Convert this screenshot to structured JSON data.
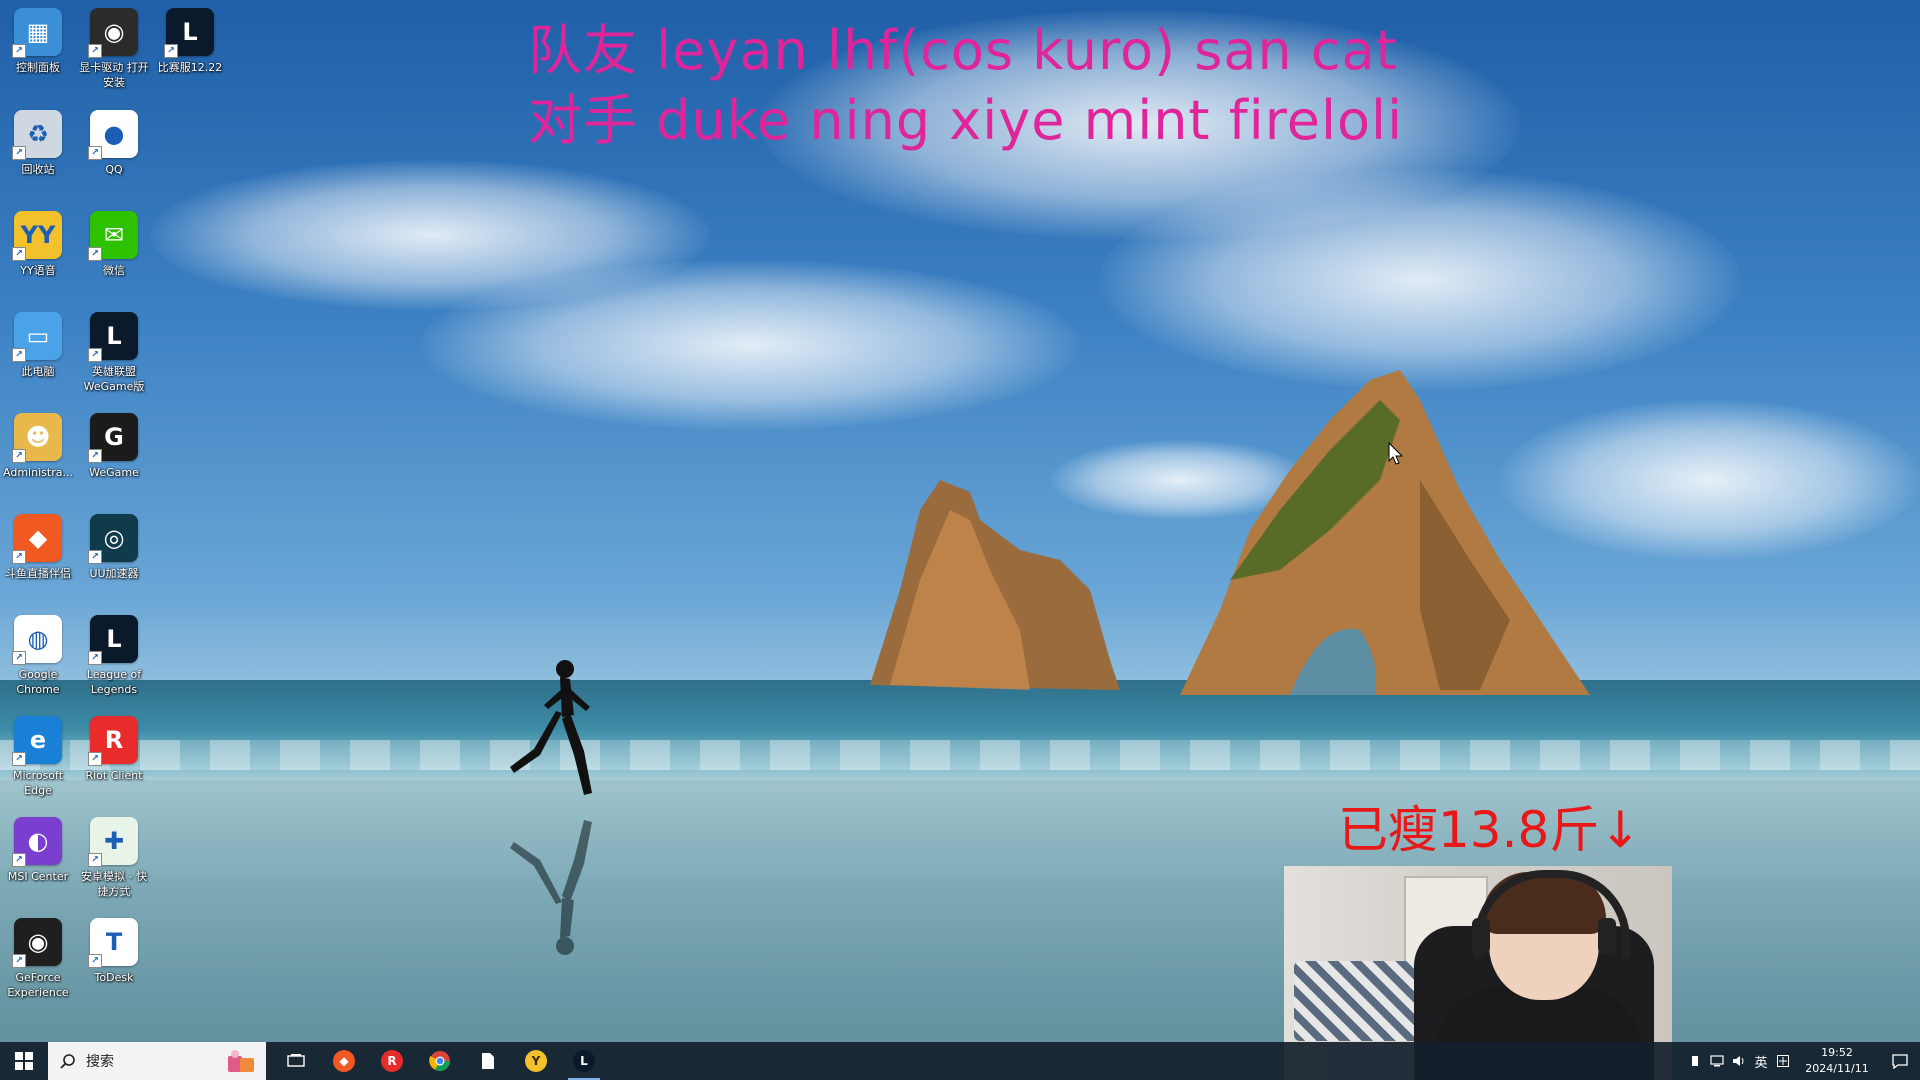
{
  "overlay": {
    "line_1": "队友 leyan lhf(cos kuro) san cat",
    "line_2": "对手 duke ning xiye mint fireloli",
    "weight_note": "已瘦13.8斤↓"
  },
  "desktop_icons": [
    {
      "label": "控制面板",
      "icon": "control-panel-icon",
      "color": "#3a8fd6"
    },
    {
      "label": "显卡驱动 打开安装",
      "icon": "nvidia-icon",
      "color": "#2b2b2b"
    },
    {
      "label": "比赛服12.22",
      "icon": "league-icon",
      "color": "#0a1a2a"
    },
    {
      "label": "回收站",
      "icon": "recycle-bin-icon",
      "color": "#cfd8e0"
    },
    {
      "label": "QQ",
      "icon": "qq-penguin-icon",
      "color": "#ffffff"
    },
    {
      "label": "YY语音",
      "icon": "yy-icon",
      "color": "#f3c12b"
    },
    {
      "label": "微信",
      "icon": "wechat-icon",
      "color": "#2dc100"
    },
    {
      "label": "此电脑",
      "icon": "this-pc-icon",
      "color": "#4aa3e8"
    },
    {
      "label": "英雄联盟 WeGame版",
      "icon": "league-icon",
      "color": "#0a1a2a"
    },
    {
      "label": "Administra...",
      "icon": "user-folder-icon",
      "color": "#e8b84a"
    },
    {
      "label": "WeGame",
      "icon": "wegame-icon",
      "color": "#1b1b1b"
    },
    {
      "label": "斗鱼直播伴侣",
      "icon": "douyu-icon",
      "color": "#f05a22"
    },
    {
      "label": "UU加速器",
      "icon": "uu-accelerator-icon",
      "color": "#0f3b4a"
    },
    {
      "label": "Google Chrome",
      "icon": "chrome-icon",
      "color": "#ffffff"
    },
    {
      "label": "League of Legends",
      "icon": "league-icon",
      "color": "#0a1a2a"
    },
    {
      "label": "Microsoft Edge",
      "icon": "edge-icon",
      "color": "#1a7fd6"
    },
    {
      "label": "Riot Client",
      "icon": "riot-client-icon",
      "color": "#e82b2b"
    },
    {
      "label": "MSI Center",
      "icon": "msi-center-icon",
      "color": "#7b3fd0"
    },
    {
      "label": "安卓模拟 - 快捷方式",
      "icon": "android-emulator-icon",
      "color": "#e9f4e8"
    },
    {
      "label": "GeForce Experience",
      "icon": "geforce-experience-icon",
      "color": "#1f1f1f"
    },
    {
      "label": "ToDesk",
      "icon": "todesk-icon",
      "color": "#ffffff"
    }
  ],
  "taskbar": {
    "search_placeholder": "搜索",
    "apps": [
      {
        "name": "task-view",
        "icon": "task-view-icon",
        "color": "#ffffff"
      },
      {
        "name": "douyu",
        "icon": "douyu-icon",
        "color": "#f05a22"
      },
      {
        "name": "riot-client",
        "icon": "riot-client-icon",
        "color": "#e82b2b"
      },
      {
        "name": "chrome",
        "icon": "chrome-icon",
        "color": "#ffffff"
      },
      {
        "name": "file",
        "icon": "file-icon",
        "color": "#ffffff"
      },
      {
        "name": "yy",
        "icon": "yy-icon",
        "color": "#f3c12b"
      },
      {
        "name": "league",
        "icon": "league-icon",
        "color": "#0a1a2a"
      }
    ],
    "tray": {
      "ime": "英",
      "time": "19:52",
      "date": "2024/11/11"
    }
  }
}
